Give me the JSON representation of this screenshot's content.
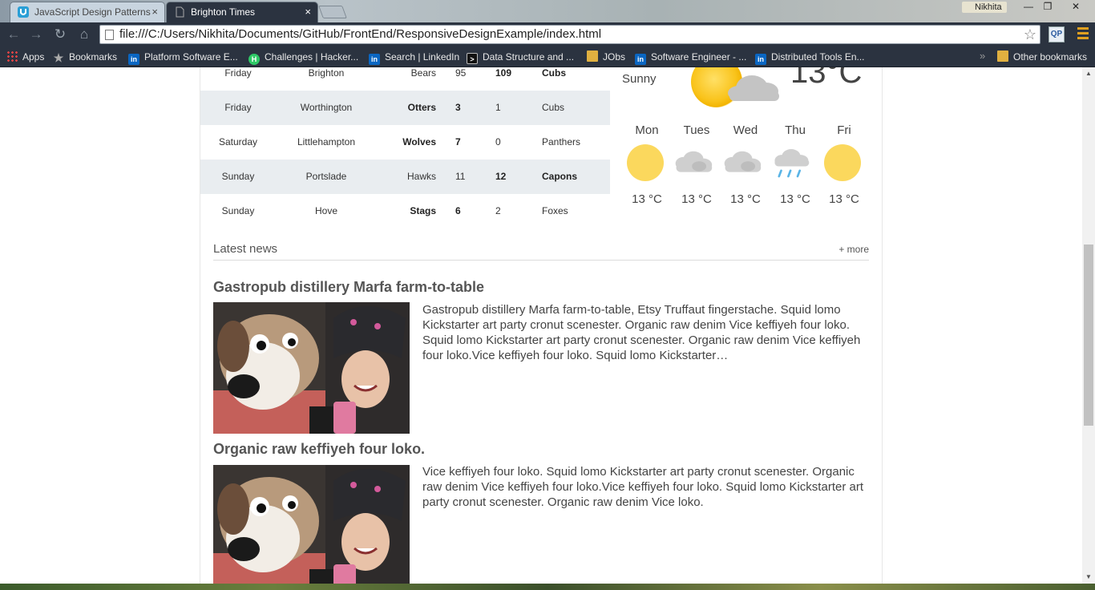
{
  "browser": {
    "tabs": [
      {
        "title": "JavaScript Design Patterns",
        "active": false
      },
      {
        "title": "Brighton Times",
        "active": true
      }
    ],
    "tab_close": "×",
    "user_name": "Nikhita",
    "url": "file:///C:/Users/Nikhita/Documents/GitHub/FrontEnd/ResponsiveDesignExample/index.html",
    "extension_label": "QP",
    "bookmarks": [
      {
        "label": "Apps",
        "icon": "apps-icon"
      },
      {
        "label": "Bookmarks",
        "icon": "star-icon"
      },
      {
        "label": "Platform Software E...",
        "icon": "linkedin-icon"
      },
      {
        "label": "Challenges | Hacker...",
        "icon": "hackerrank-icon"
      },
      {
        "label": "Search | LinkedIn",
        "icon": "linkedin-icon"
      },
      {
        "label": "Data Structure and ...",
        "icon": "terminal-icon"
      },
      {
        "label": "JObs",
        "icon": "folder-icon"
      },
      {
        "label": "Software Engineer - ...",
        "icon": "linkedin-icon"
      },
      {
        "label": "Distributed Tools En...",
        "icon": "linkedin-icon"
      }
    ],
    "bookmarks_overflow": "»",
    "other_bookmarks": "Other bookmarks"
  },
  "scores": [
    {
      "day": "Friday",
      "venue": "Brighton",
      "home": "Bears",
      "home_score": "95",
      "away_score": "109",
      "away": "Cubs",
      "winner": "away"
    },
    {
      "day": "Friday",
      "venue": "Worthington",
      "home": "Otters",
      "home_score": "3",
      "away_score": "1",
      "away": "Cubs",
      "winner": "home"
    },
    {
      "day": "Saturday",
      "venue": "Littlehampton",
      "home": "Wolves",
      "home_score": "7",
      "away_score": "0",
      "away": "Panthers",
      "winner": "home"
    },
    {
      "day": "Sunday",
      "venue": "Portslade",
      "home": "Hawks",
      "home_score": "11",
      "away_score": "12",
      "away": "Capons",
      "winner": "away"
    },
    {
      "day": "Sunday",
      "venue": "Hove",
      "home": "Stags",
      "home_score": "6",
      "away_score": "2",
      "away": "Foxes",
      "winner": "home"
    }
  ],
  "weather": {
    "condition": "Sunny",
    "temp": "13°C",
    "forecast": [
      {
        "day": "Mon",
        "icon": "sun-icon",
        "temp": "13 °C"
      },
      {
        "day": "Tues",
        "icon": "cloud-icon",
        "temp": "13 °C"
      },
      {
        "day": "Wed",
        "icon": "cloud-icon",
        "temp": "13 °C"
      },
      {
        "day": "Thu",
        "icon": "rain-icon",
        "temp": "13 °C"
      },
      {
        "day": "Fri",
        "icon": "sun-icon",
        "temp": "13 °C"
      }
    ]
  },
  "news": {
    "title": "Latest news",
    "more": "+ more",
    "articles": [
      {
        "headline": "Gastropub distillery Marfa farm-to-table",
        "body": "Gastropub distillery Marfa farm-to-table, Etsy Truffaut fingerstache. Squid lomo Kickstarter art party cronut scenester. Organic raw denim Vice keffiyeh four loko. Squid lomo Kickstarter art party cronut scenester. Organic raw denim Vice keffiyeh four loko.Vice keffiyeh four loko. Squid lomo Kickstarter…"
      },
      {
        "headline": "Organic raw keffiyeh four loko.",
        "body": "Vice keffiyeh four loko. Squid lomo Kickstarter art party cronut scenester. Organic raw denim Vice keffiyeh four loko.Vice keffiyeh four loko. Squid lomo Kickstarter art party cronut scenester. Organic raw denim Vice loko."
      }
    ]
  },
  "colors": {
    "chrome_dark": "#2b3340",
    "row_alt": "#e9edf0",
    "sun_yellow": "#fbd85d",
    "cloud_grey": "#c8c8c8",
    "rain_blue": "#5ab4e6"
  }
}
